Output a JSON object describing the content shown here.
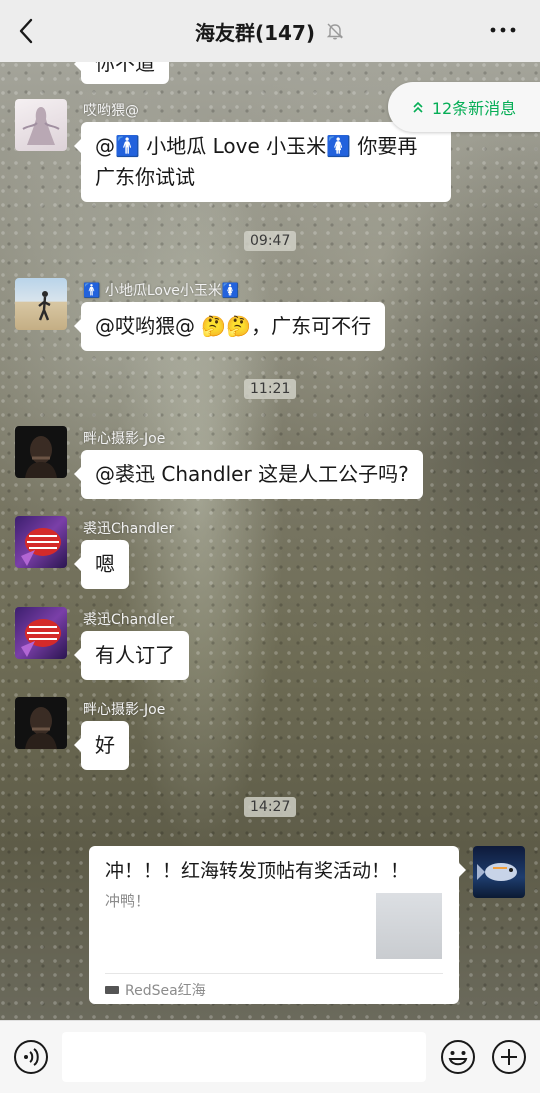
{
  "header": {
    "title": "海友群(147)",
    "back_icon": "chevron-left-icon",
    "mute_icon": "bell-off-icon",
    "more_icon": "more-dots-icon"
  },
  "new_messages": {
    "label": "12条新消息",
    "icon": "double-chevron-up-icon",
    "color": "#06ae56"
  },
  "messages": [
    {
      "type": "text",
      "text": "你不道"
    },
    {
      "type": "text",
      "sender": "哎哟猥@",
      "text": "@🚹 小地瓜 Love 小玉米🚺 你要再广东你试试"
    },
    {
      "type": "time",
      "text": "09:47"
    },
    {
      "type": "text",
      "sender": "🚹 小地瓜Love小玉米🚺",
      "text": "@哎哟猥@ 🤔🤔，广东可不行"
    },
    {
      "type": "time",
      "text": "11:21"
    },
    {
      "type": "text",
      "sender": "畔心摄影-Joe",
      "text": "@裘迅 Chandler  这是人工公子吗?"
    },
    {
      "type": "text",
      "sender": "裘迅Chandler",
      "text": "嗯"
    },
    {
      "type": "text",
      "sender": "裘迅Chandler",
      "text": "有人订了"
    },
    {
      "type": "text",
      "sender": "畔心摄影-Joe",
      "text": "好"
    },
    {
      "type": "time",
      "text": "14:27"
    },
    {
      "type": "link-card",
      "title": "冲！！！红海转发顶帖有奖活动！！",
      "desc": "冲鸭！",
      "source": "RedSea红海"
    }
  ],
  "input": {
    "placeholder": ""
  },
  "bottom_bar": {
    "voice_icon": "voice-icon",
    "emoji_icon": "emoji-icon",
    "plus_icon": "plus-icon"
  }
}
